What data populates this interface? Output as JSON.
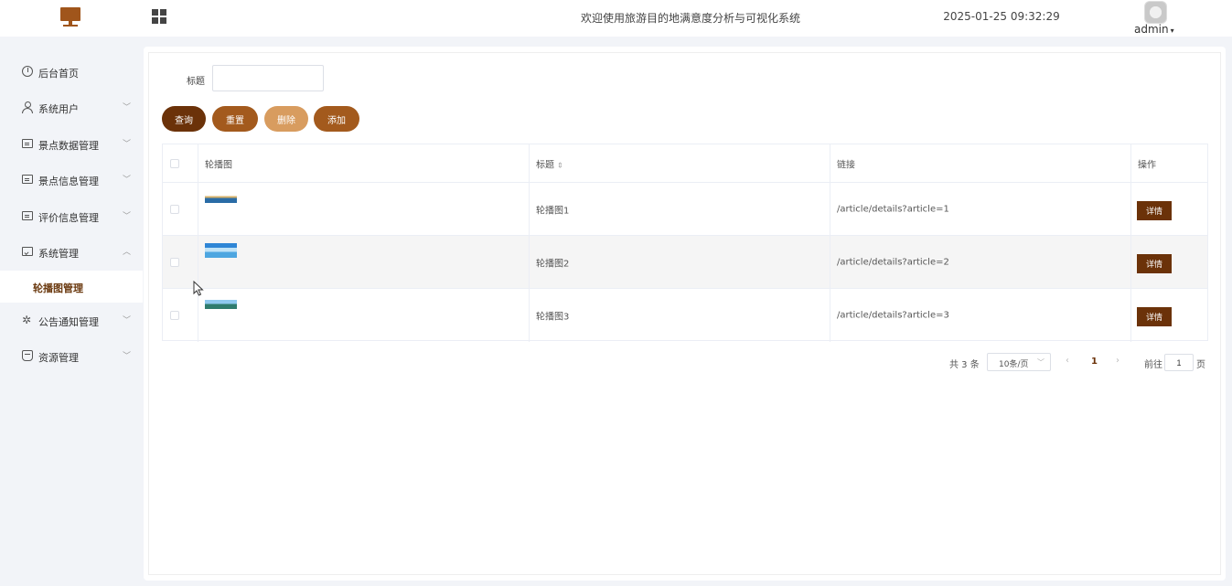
{
  "header": {
    "title": "欢迎使用旅游目的地满意度分析与可视化系统",
    "datetime": "2025-01-25 09:32:29",
    "user": "admin",
    "logo_icon": "monitor-icon",
    "menu_toggle_icon": "grid-icon"
  },
  "sidebar": {
    "items": [
      {
        "label": "后台首页",
        "icon": "clock-icon",
        "arrow": ""
      },
      {
        "label": "系统用户",
        "icon": "user-icon",
        "arrow": "﹀"
      },
      {
        "label": "景点数据管理",
        "icon": "card-icon",
        "arrow": "﹀"
      },
      {
        "label": "景点信息管理",
        "icon": "card-icon",
        "arrow": "﹀"
      },
      {
        "label": "评价信息管理",
        "icon": "card-icon",
        "arrow": "﹀"
      },
      {
        "label": "系统管理",
        "icon": "folder-icon",
        "arrow": "︿"
      },
      {
        "label": "公告通知管理",
        "icon": "sparkle-icon",
        "arrow": "﹀"
      },
      {
        "label": "资源管理",
        "icon": "box-icon",
        "arrow": "﹀"
      }
    ],
    "submenu_active": "轮播图管理"
  },
  "search": {
    "label": "标题",
    "value": "",
    "placeholder": ""
  },
  "toolbar": {
    "query": "查询",
    "reset": "重置",
    "delete": "删除",
    "add": "添加"
  },
  "table": {
    "columns": [
      "轮播图",
      "标题",
      "链接",
      "操作"
    ],
    "sort_icon": "⇕",
    "rows": [
      {
        "title": "轮播图1",
        "link": "/article/details?article=1",
        "action": "详情"
      },
      {
        "title": "轮播图2",
        "link": "/article/details?article=2",
        "action": "详情"
      },
      {
        "title": "轮播图3",
        "link": "/article/details?article=3",
        "action": "详情"
      }
    ]
  },
  "pagination": {
    "total": "共 3 条",
    "page_size": "10条/页",
    "current": "1",
    "goto_label": "前往",
    "goto_value": "1",
    "page_suffix": "页"
  },
  "colors": {
    "primary_dark": "#6b3209",
    "primary": "#a35a1d",
    "primary_light": "#d89c5f"
  }
}
